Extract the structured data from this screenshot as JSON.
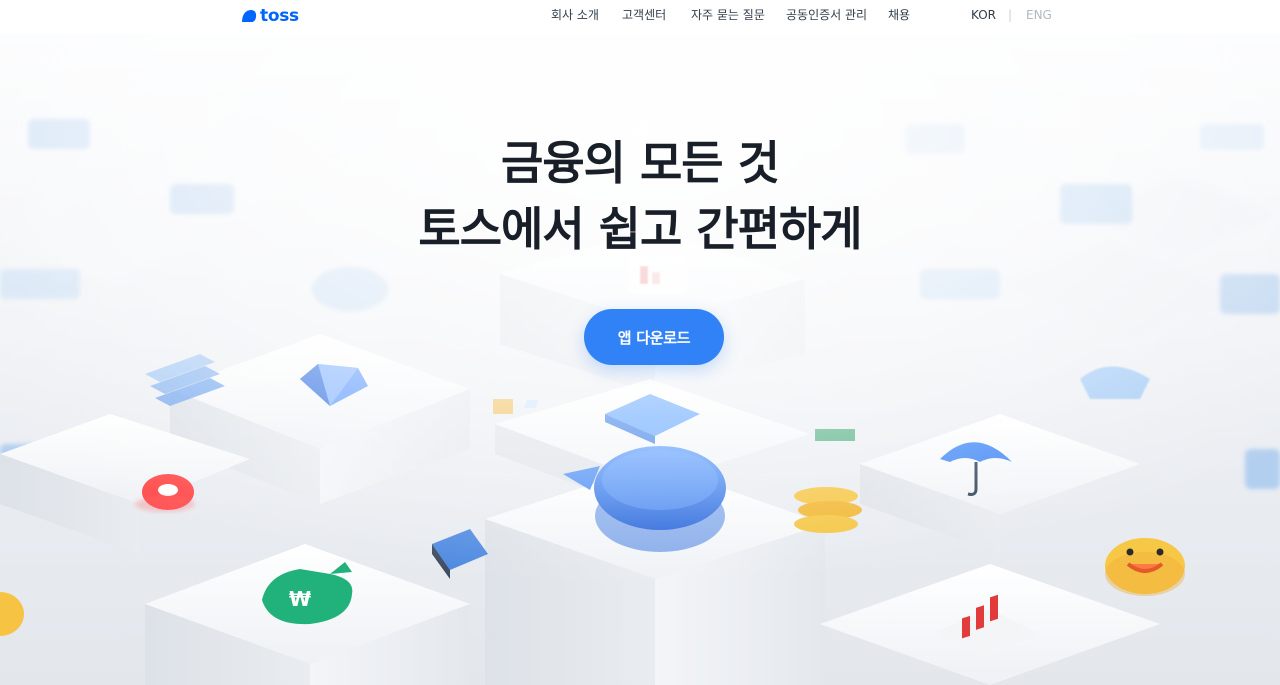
{
  "header": {
    "logo_text": "toss",
    "nav": [
      {
        "label": "회사 소개"
      },
      {
        "label": "고객센터"
      },
      {
        "label": "자주 묻는 질문"
      },
      {
        "label": "공동인증서 관리"
      },
      {
        "label": "채용"
      }
    ],
    "lang": {
      "kor": "KOR",
      "separator": "|",
      "eng": "ENG"
    }
  },
  "hero": {
    "title_line1": "금융의 모든 것",
    "title_line2": "토스에서 쉽고 간편하게",
    "download_label": "앱 다운로드"
  },
  "colors": {
    "brand_blue": "#0064ff",
    "button_blue": "#3182f6",
    "title_text": "#191f28",
    "nav_text": "#333d4b"
  },
  "icons": [
    "toss-logo-icon",
    "speech-bubble-icon",
    "card-icon",
    "diamond-icon",
    "umbrella-icon",
    "money-bag-icon",
    "smile-icon",
    "coin-stack-icon",
    "red-ring-icon",
    "chart-icon"
  ]
}
